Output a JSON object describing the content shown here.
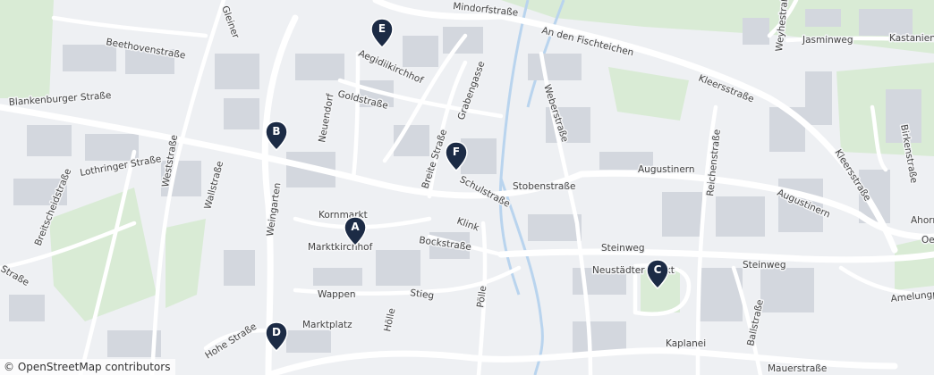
{
  "streets": [
    "Beethovenstraße",
    "Blankenburger Straße",
    "Weststraße",
    "Lothringer Straße",
    "Wallstraße",
    "Breitscheidstraße",
    "Weingarten",
    "Neuendorf",
    "Goldstraße",
    "Aegidiikirchhof",
    "Grabengasse",
    "Breite Straße",
    "Schulstraße",
    "Stobenstraße",
    "Kornmarkt",
    "Marktkirchhof",
    "Klink",
    "Bockstraße",
    "Wappen",
    "Stieg",
    "Marktplatz",
    "Hohe Straße",
    "Hölle",
    "Pölle",
    "Weberstraße",
    "An den Fischteichen",
    "Kleersstraße",
    "Augustinern",
    "Reichenstraße",
    "Steinweg",
    "Neustädter Markt",
    "Kaplanei",
    "Ballstraße",
    "Mauerstraße",
    "Jasminweg",
    "Kastanienstraße",
    "Weyhestraße",
    "Birkenstraße",
    "Ahorn",
    "Amelungpark",
    "Gleiner",
    "Mindorfstraße",
    "Oe",
    "Straße"
  ],
  "markers": [
    {
      "label": "A",
      "color": "#1c2b45"
    },
    {
      "label": "B",
      "color": "#1c2b45"
    },
    {
      "label": "C",
      "color": "#1c2b45"
    },
    {
      "label": "D",
      "color": "#1c2b45"
    },
    {
      "label": "E",
      "color": "#1c2b45"
    },
    {
      "label": "F",
      "color": "#1c2b45"
    }
  ],
  "attribution": {
    "symbol": "©",
    "text": "OpenStreetMap contributors"
  },
  "colors": {
    "background": "#eef0f3",
    "road": "#ffffff",
    "building": "#d3d7de",
    "green": "#d9ebd5",
    "water": "#b9d4ee",
    "marker": "#1c2b45"
  }
}
